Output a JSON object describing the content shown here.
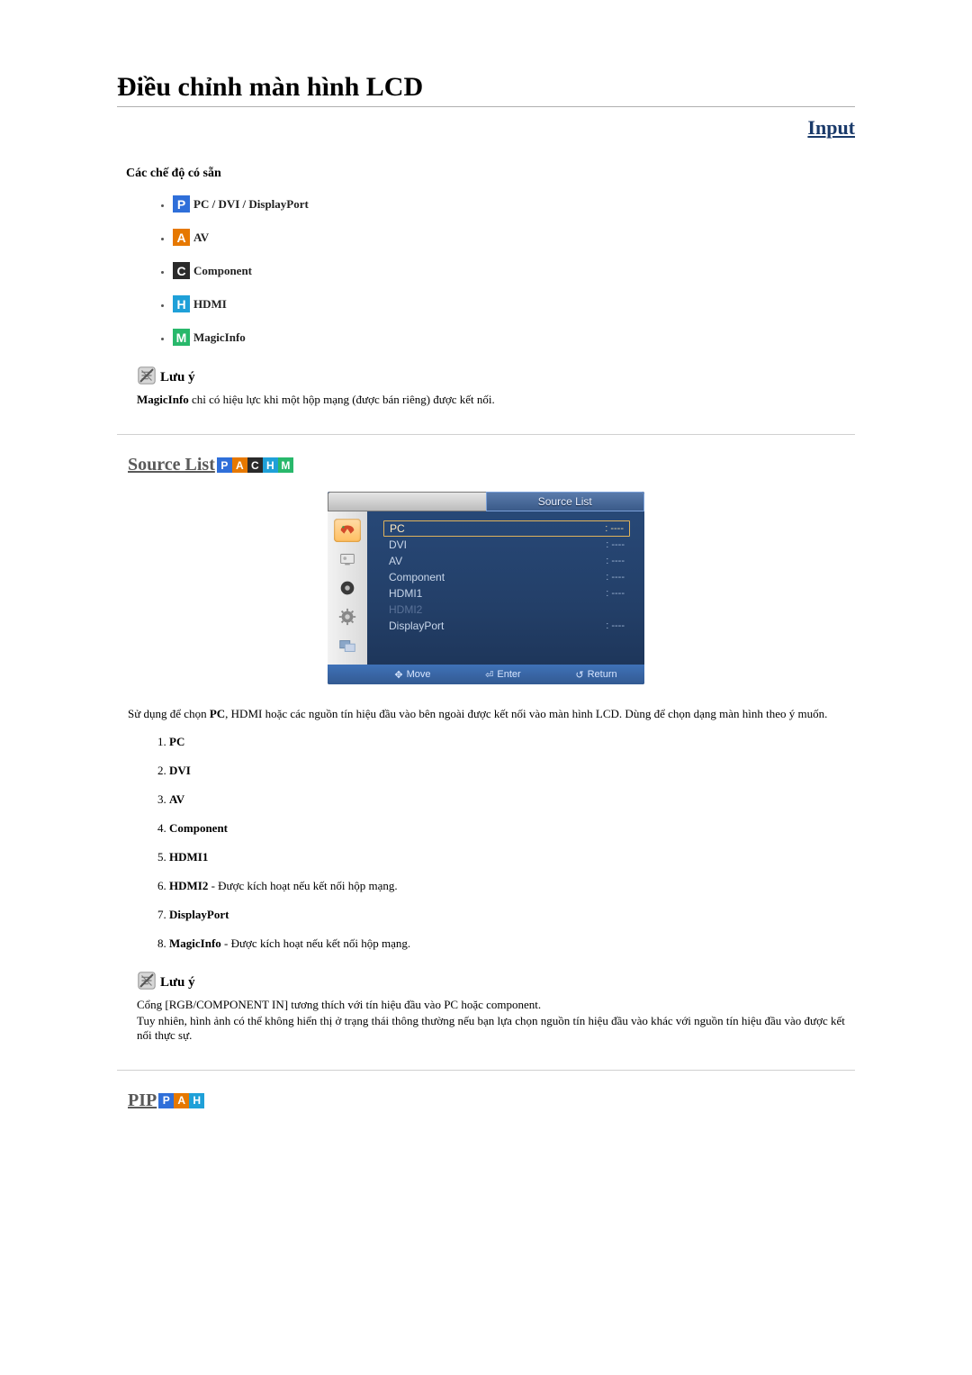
{
  "page": {
    "title": "Điều chỉnh màn hình LCD",
    "input_link": "Input"
  },
  "modes": {
    "heading": "Các chế độ có sẵn",
    "items": [
      {
        "badge": "P",
        "cls": "badge-p",
        "label": "PC / DVI / DisplayPort"
      },
      {
        "badge": "A",
        "cls": "badge-a",
        "label": "AV"
      },
      {
        "badge": "C",
        "cls": "badge-c",
        "label": "Component"
      },
      {
        "badge": "H",
        "cls": "badge-h",
        "label": "HDMI"
      },
      {
        "badge": "M",
        "cls": "badge-m",
        "label": "MagicInfo"
      }
    ]
  },
  "note1": {
    "title": "Lưu ý",
    "body_bold": "MagicInfo",
    "body_rest": " chỉ có hiệu lực khi một hộp mạng (được bán riêng) được kết nối."
  },
  "source_list": {
    "title": "Source List",
    "badges": [
      "P",
      "A",
      "C",
      "H",
      "M"
    ]
  },
  "osd": {
    "tab_title": "Source List",
    "rows": [
      {
        "label": "PC",
        "val": ": ----",
        "state": "selected"
      },
      {
        "label": "DVI",
        "val": ": ----",
        "state": ""
      },
      {
        "label": "AV",
        "val": ": ----",
        "state": ""
      },
      {
        "label": "Component",
        "val": ": ----",
        "state": ""
      },
      {
        "label": "HDMI1",
        "val": ": ----",
        "state": ""
      },
      {
        "label": "HDMI2",
        "val": "",
        "state": "disabled"
      },
      {
        "label": "DisplayPort",
        "val": ": ----",
        "state": ""
      }
    ],
    "footer": {
      "move": "Move",
      "enter": "Enter",
      "ret": "Return"
    }
  },
  "desc": {
    "p1a": "Sử dụng để chọn ",
    "p1b": "PC",
    "p1c": ", HDMI hoặc các nguồn tín hiệu đầu vào bên ngoài được kết nối vào màn hình LCD. Dùng để chọn dạng màn hình theo ý muốn."
  },
  "list": [
    {
      "b": "PC",
      "rest": ""
    },
    {
      "b": "DVI",
      "rest": ""
    },
    {
      "b": "AV",
      "rest": ""
    },
    {
      "b": "Component",
      "rest": ""
    },
    {
      "b": "HDMI1",
      "rest": ""
    },
    {
      "b": "HDMI2",
      "rest": " - Được kích hoạt nếu kết nối hộp mạng."
    },
    {
      "b": "DisplayPort",
      "rest": ""
    },
    {
      "b": "MagicInfo",
      "rest": " - Được kích hoạt nếu kết nối hộp mạng."
    }
  ],
  "note2": {
    "title": "Lưu ý",
    "line1": "Cổng [RGB/COMPONENT IN] tương thích với tín hiệu đầu vào PC hoặc component.",
    "line2": "Tuy nhiên, hình ảnh có thể không hiển thị ở trạng thái thông thường nếu bạn lựa chọn nguồn tín hiệu đầu vào khác với nguồn tín hiệu đầu vào được kết nối thực sự."
  },
  "pip": {
    "title": "PIP",
    "badges": [
      "P",
      "A",
      "H"
    ]
  }
}
